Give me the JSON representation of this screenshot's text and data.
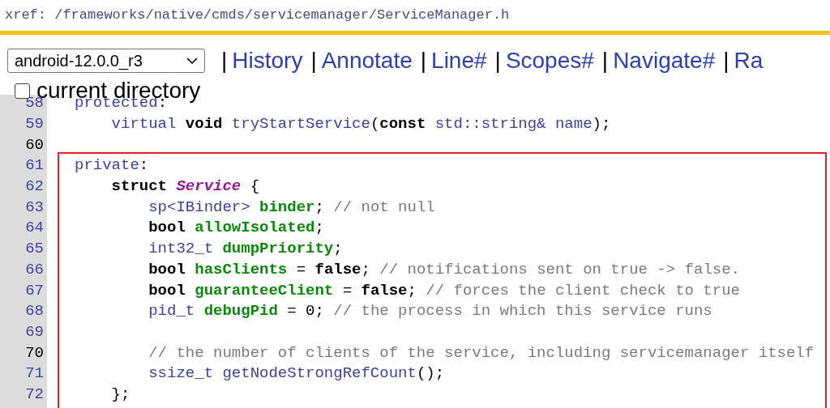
{
  "path_bar": {
    "text": "xref: /frameworks/native/cmds/servicemanager/ServiceManager.h"
  },
  "toolbar": {
    "version_select": {
      "value": "android-12.0.0_r3"
    },
    "separator": "|",
    "links": [
      {
        "label": "History"
      },
      {
        "label": "Annotate"
      },
      {
        "label": "Line#"
      },
      {
        "label": "Scopes#"
      },
      {
        "label": "Navigate#"
      },
      {
        "label": "Ra"
      }
    ]
  },
  "current_directory": {
    "label": "current directory",
    "checked": false
  },
  "code": {
    "sections": [
      {
        "boxed": false,
        "lines": [
          {
            "number": "58",
            "dark": false,
            "tokens": [
              {
                "t": "protected",
                "kind": "type"
              },
              {
                "t": ":",
                "kind": "punct"
              }
            ]
          },
          {
            "number": "59",
            "dark": false,
            "tokens": [
              {
                "t": "    virtual ",
                "kind": "type"
              },
              {
                "t": "void ",
                "kind": "keyword"
              },
              {
                "t": "tryStartService",
                "kind": "type"
              },
              {
                "t": "(",
                "kind": "punct"
              },
              {
                "t": "const ",
                "kind": "keyword"
              },
              {
                "t": "std::string& name",
                "kind": "type"
              },
              {
                "t": ");",
                "kind": "punct"
              }
            ]
          },
          {
            "number": "60",
            "dark": true
          }
        ]
      },
      {
        "boxed": true,
        "lines": [
          {
            "number": "61",
            "dark": false,
            "tokens": [
              {
                "t": "private",
                "kind": "type"
              },
              {
                "t": ":",
                "kind": "punct"
              }
            ]
          },
          {
            "number": "62",
            "dark": false,
            "tokens": [
              {
                "t": "    struct ",
                "kind": "keyword"
              },
              {
                "t": "Service",
                "kind": "class"
              },
              {
                "t": " {",
                "kind": "punct"
              }
            ]
          },
          {
            "number": "63",
            "dark": false,
            "tokens": [
              {
                "t": "        sp<IBinder> ",
                "kind": "type"
              },
              {
                "t": "binder",
                "kind": "ident"
              },
              {
                "t": "; ",
                "kind": "punct"
              },
              {
                "t": "// not null",
                "kind": "comment"
              }
            ]
          },
          {
            "number": "64",
            "dark": false,
            "tokens": [
              {
                "t": "        bool ",
                "kind": "keyword"
              },
              {
                "t": "allowIsolated",
                "kind": "ident"
              },
              {
                "t": ";",
                "kind": "punct"
              }
            ]
          },
          {
            "number": "65",
            "dark": false,
            "tokens": [
              {
                "t": "        int32_t ",
                "kind": "type"
              },
              {
                "t": "dumpPriority",
                "kind": "ident"
              },
              {
                "t": ";",
                "kind": "punct"
              }
            ]
          },
          {
            "number": "66",
            "dark": false,
            "tokens": [
              {
                "t": "        bool ",
                "kind": "keyword"
              },
              {
                "t": "hasClients",
                "kind": "ident"
              },
              {
                "t": " = ",
                "kind": "punct"
              },
              {
                "t": "false",
                "kind": "keyword"
              },
              {
                "t": "; ",
                "kind": "punct"
              },
              {
                "t": "// notifications sent on true -> false.",
                "kind": "comment"
              }
            ]
          },
          {
            "number": "67",
            "dark": false,
            "tokens": [
              {
                "t": "        bool ",
                "kind": "keyword"
              },
              {
                "t": "guaranteeClient",
                "kind": "ident"
              },
              {
                "t": " = ",
                "kind": "punct"
              },
              {
                "t": "false",
                "kind": "keyword"
              },
              {
                "t": "; ",
                "kind": "punct"
              },
              {
                "t": "// forces the client check to true",
                "kind": "comment"
              }
            ]
          },
          {
            "number": "68",
            "dark": false,
            "tokens": [
              {
                "t": "        pid_t ",
                "kind": "type"
              },
              {
                "t": "debugPid",
                "kind": "ident"
              },
              {
                "t": " = 0; ",
                "kind": "punct"
              },
              {
                "t": "// the process in which this service runs",
                "kind": "comment"
              }
            ]
          },
          {
            "number": "69",
            "dark": false
          },
          {
            "number": "70",
            "dark": true,
            "tokens": [
              {
                "t": "        // the number of clients of the service, including servicemanager itself",
                "kind": "comment"
              }
            ]
          },
          {
            "number": "71",
            "dark": false,
            "tokens": [
              {
                "t": "        ssize_t getNodeStrongRefCount",
                "kind": "type"
              },
              {
                "t": "();",
                "kind": "punct"
              }
            ]
          },
          {
            "number": "72",
            "dark": false,
            "tokens": [
              {
                "t": "    };",
                "kind": "punct"
              }
            ]
          }
        ]
      }
    ]
  }
}
